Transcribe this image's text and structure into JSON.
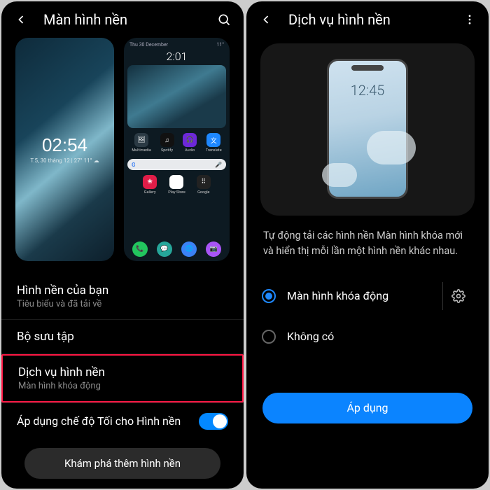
{
  "left": {
    "header_title": "Màn hình nền",
    "lock_preview": {
      "time": "02:54",
      "date": "T.5, 30 tháng 12 | 27° 11° ☁"
    },
    "home_preview": {
      "day": "Thu 30 December",
      "time": "2:01",
      "weather": "11°",
      "row1": [
        "Multimedia",
        "Spotify",
        "Audio",
        "Translate"
      ],
      "row2": [
        "Gallery",
        "Play Store",
        "Google"
      ],
      "dock_colors": [
        "#22c55e",
        "#26a69a",
        "#3b82f6",
        "#a855f7"
      ]
    },
    "your_wallpapers_title": "Hình nền của bạn",
    "your_wallpapers_sub": "Tiêu biểu và đã tải về",
    "collection": "Bộ sưu tập",
    "service_title": "Dịch vụ hình nền",
    "service_sub": "Màn hình khóa động",
    "dark_mode_label": "Áp dụng chế độ Tối cho Hình nền",
    "explore_btn": "Khám phá thêm hình nền"
  },
  "right": {
    "header_title": "Dịch vụ hình nền",
    "mini_time": "12:45",
    "description": "Tự động tải các hình nền Màn hình khóa mới và hiển thị mỗi lần một hình nền khác nhau.",
    "opt_dynamic": "Màn hình khóa động",
    "opt_none": "Không có",
    "apply": "Áp dụng"
  }
}
